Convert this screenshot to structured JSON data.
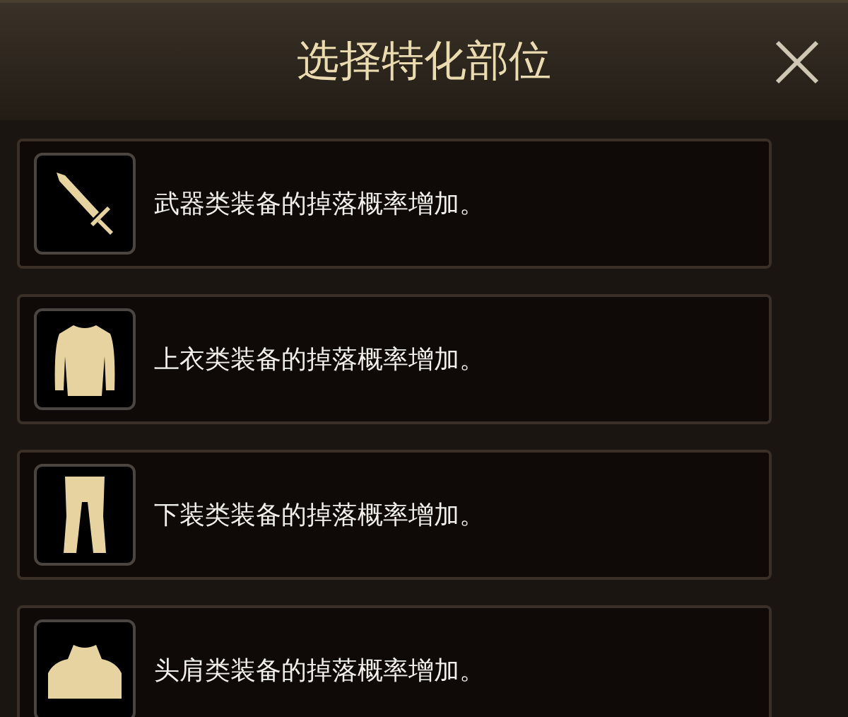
{
  "dialog": {
    "title": "选择特化部位"
  },
  "options": [
    {
      "kind": "weapon",
      "text": "武器类装备的掉落概率增加。"
    },
    {
      "kind": "top",
      "text": "上衣类装备的掉落概率增加。"
    },
    {
      "kind": "bottom",
      "text": "下装类装备的掉落概率增加。"
    },
    {
      "kind": "shoulder",
      "text": "头肩类装备的掉落概率增加。"
    }
  ]
}
